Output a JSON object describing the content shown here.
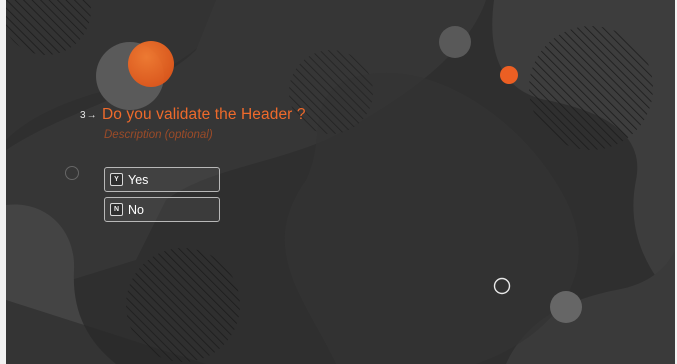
{
  "question": {
    "number": "3",
    "arrow_icon": "arrow-right-icon",
    "title": "Do you validate the Header ?",
    "description_placeholder": "Description (optional)"
  },
  "choices": [
    {
      "key": "Y",
      "label": "Yes"
    },
    {
      "key": "N",
      "label": "No"
    }
  ],
  "colors": {
    "accent": "#ef6a2b",
    "background": "#2f2f2f",
    "description": "#9b4b28"
  }
}
